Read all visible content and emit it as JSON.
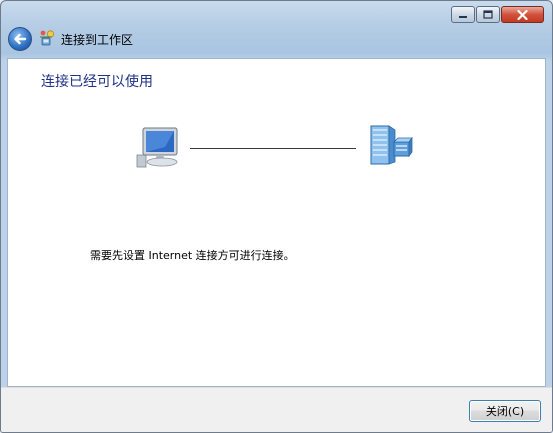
{
  "window": {
    "title": "连接到工作区",
    "caption_buttons": {
      "minimize": "minimize-icon",
      "maximize": "maximize-icon",
      "close": "close-icon"
    }
  },
  "nav": {
    "back_icon": "back-arrow-icon"
  },
  "main": {
    "heading": "连接已经可以使用",
    "status_message": "需要先设置 Internet 连接方可进行连接。",
    "icons": {
      "left": "computer-icon",
      "right": "server-icon"
    }
  },
  "footer": {
    "close_label": "关闭(C)"
  },
  "colors": {
    "heading": "#1e3287",
    "accent": "#3c7fb1",
    "close_caption": "#c8432b"
  }
}
